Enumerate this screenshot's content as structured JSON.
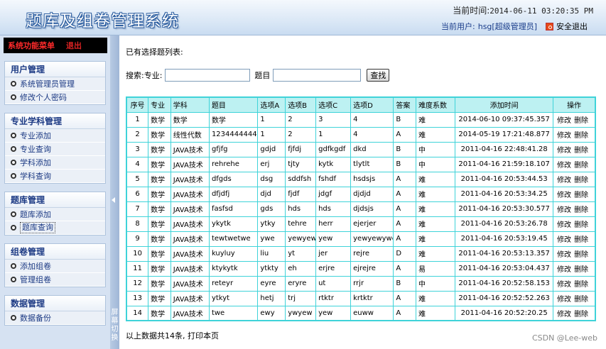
{
  "header": {
    "title": "题库及组卷管理系统",
    "time_label": "当前时间:",
    "time_value": "2014-06-11 03:20:35 PM",
    "user_label": "当前用户:",
    "user_name": "hsg[超级管理员]",
    "logout_label": "安全退出"
  },
  "sidebar": {
    "menu_title": "系统功能菜单",
    "exit_label": "退出",
    "groups": [
      {
        "title": "用户管理",
        "items": [
          "系统管理员管理",
          "修改个人密码"
        ]
      },
      {
        "title": "专业学科管理",
        "items": [
          "专业添加",
          "专业查询",
          "学科添加",
          "学科查询"
        ]
      },
      {
        "title": "题库管理",
        "items": [
          "题库添加",
          "题库查询"
        ]
      },
      {
        "title": "组卷管理",
        "items": [
          "添加组卷",
          "管理组卷"
        ]
      },
      {
        "title": "数据管理",
        "items": [
          "数据备份"
        ]
      }
    ],
    "toggle_text": "屏幕切换"
  },
  "main": {
    "selected_label": "已有选择题列表:",
    "search_label": "搜索:专业:",
    "subject_label": "题目",
    "major_value": "",
    "keyword_value": "",
    "search_button": "查找",
    "columns": [
      "序号",
      "专业",
      "学科",
      "题目",
      "选项A",
      "选项B",
      "选项C",
      "选项D",
      "答案",
      "难度系数",
      "添加时间",
      "操作"
    ],
    "rows": [
      [
        "1",
        "数学",
        "数学",
        "数学",
        "1",
        "2",
        "3",
        "4",
        "B",
        "难",
        "2014-06-10 09:37:45.357"
      ],
      [
        "2",
        "数学",
        "线性代数",
        "1234444444",
        "1",
        "2",
        "1",
        "4",
        "A",
        "难",
        "2014-05-19 17:21:48.877"
      ],
      [
        "3",
        "数学",
        "JAVA技术",
        "gfjfg",
        "gdjd",
        "fjfdj",
        "gdfkgdf",
        "dkd",
        "B",
        "中",
        "2011-04-16 22:48:41.28"
      ],
      [
        "4",
        "数学",
        "JAVA技术",
        "rehrehe",
        "erj",
        "tjty",
        "kytk",
        "tlytlt",
        "B",
        "中",
        "2011-04-16 21:59:18.107"
      ],
      [
        "5",
        "数学",
        "JAVA技术",
        "dfgds",
        "dsg",
        "sddfsh",
        "fshdf",
        "hsdsjs",
        "A",
        "难",
        "2011-04-16 20:53:44.53"
      ],
      [
        "6",
        "数学",
        "JAVA技术",
        "dfjdfj",
        "djd",
        "fjdf",
        "jdgf",
        "djdjd",
        "A",
        "难",
        "2011-04-16 20:53:34.25"
      ],
      [
        "7",
        "数学",
        "JAVA技术",
        "fasfsd",
        "gds",
        "hds",
        "hds",
        "djdsjs",
        "A",
        "难",
        "2011-04-16 20:53:30.577"
      ],
      [
        "8",
        "数学",
        "JAVA技术",
        "ykytk",
        "ytky",
        "tehre",
        "herr",
        "ejerjer",
        "A",
        "难",
        "2011-04-16 20:53:26.78"
      ],
      [
        "9",
        "数学",
        "JAVA技术",
        "tewtwetwe",
        "ywe",
        "yewyew",
        "yew",
        "yewyewywe",
        "A",
        "难",
        "2011-04-16 20:53:19.45"
      ],
      [
        "10",
        "数学",
        "JAVA技术",
        "kuyluy",
        "liu",
        "yt",
        "jer",
        "rejre",
        "D",
        "难",
        "2011-04-16 20:53:13.357"
      ],
      [
        "11",
        "数学",
        "JAVA技术",
        "ktykytk",
        "ytkty",
        "eh",
        "erjre",
        "ejrejre",
        "A",
        "易",
        "2011-04-16 20:53:04.437"
      ],
      [
        "12",
        "数学",
        "JAVA技术",
        "reteyr",
        "eyre",
        "eryre",
        "ut",
        "rrjr",
        "B",
        "中",
        "2011-04-16 20:52:58.153"
      ],
      [
        "13",
        "数学",
        "JAVA技术",
        "ytkyt",
        "hetj",
        "trj",
        "rtktr",
        "krtktr",
        "A",
        "难",
        "2011-04-16 20:52:52.263"
      ],
      [
        "14",
        "数学",
        "JAVA技术",
        "twe",
        "ewy",
        "ywyew",
        "yew",
        "euww",
        "A",
        "难",
        "2011-04-16 20:52:20.25"
      ]
    ],
    "edit_label": "修改",
    "delete_label": "删除",
    "footer": "以上数据共14条, 打印本页"
  },
  "watermark": "CSDN @Lee-web"
}
